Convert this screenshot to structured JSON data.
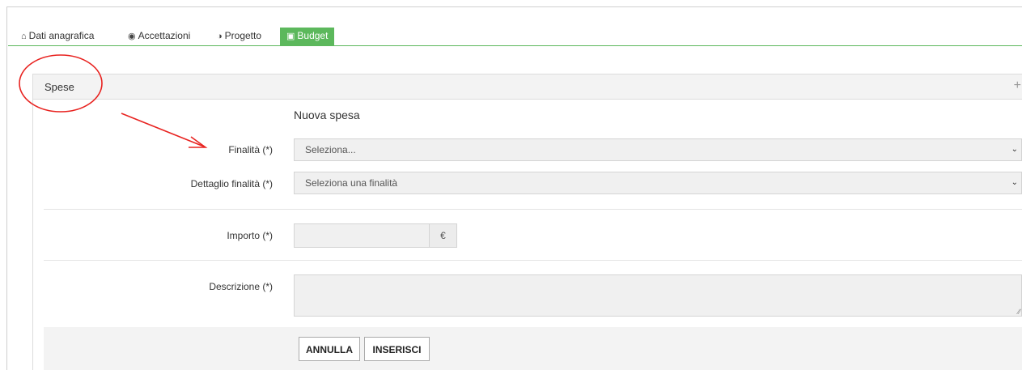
{
  "tabs": [
    {
      "label": "Dati anagrafica",
      "icon": "home-icon",
      "glyph": "⌂",
      "active": false
    },
    {
      "label": "Accettazioni",
      "icon": "eye-icon",
      "glyph": "◉",
      "active": false
    },
    {
      "label": "Progetto",
      "icon": "globe-icon",
      "glyph": "◑",
      "active": false
    },
    {
      "label": "Budget",
      "icon": "money-icon",
      "glyph": "▣",
      "active": true
    }
  ],
  "panel": {
    "title": "Spese",
    "toggle": "+"
  },
  "form": {
    "title": "Nuova spesa",
    "finalita": {
      "label": "Finalità (*)",
      "value": "Seleziona..."
    },
    "dettaglio": {
      "label": "Dettaglio finalità (*)",
      "value": "Seleziona una finalità"
    },
    "importo": {
      "label": "Importo (*)",
      "value": "",
      "currency": "€"
    },
    "descrizione": {
      "label": "Descrizione (*)",
      "value": ""
    }
  },
  "buttons": {
    "cancel": "ANNULLA",
    "insert": "INSERISCI"
  },
  "colors": {
    "accent": "#5cb85c",
    "annotation": "#e8221f"
  }
}
